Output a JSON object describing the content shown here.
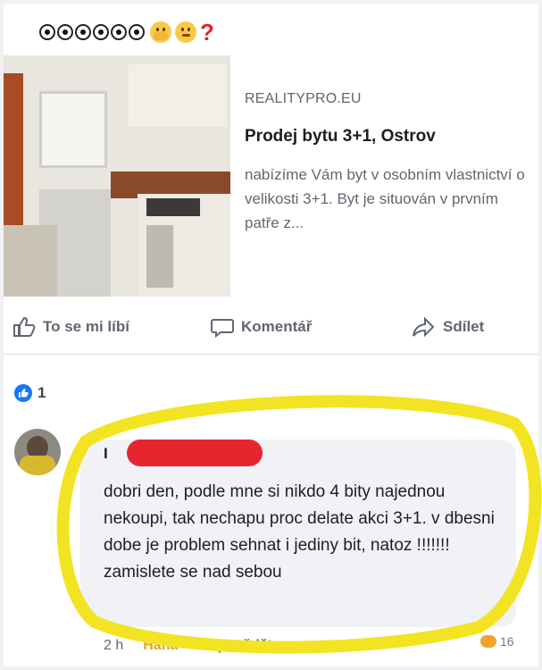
{
  "post": {
    "header_suffix": "?"
  },
  "link_preview": {
    "source": "REALITYPRO.EU",
    "title": "Prodej bytu 3+1, Ostrov",
    "description": "nabízíme Vám byt v osobním vlastnictví o velikosti 3+1. Byt je situován v prvním patře z..."
  },
  "actions": {
    "like": "To se mi líbí",
    "comment": "Komentář",
    "share": "Sdílet"
  },
  "reactions": {
    "count": "1"
  },
  "comment": {
    "author_initial": "I",
    "text": "dobri den, podle mne si nikdo 4 bity najednou nekoupi, tak nechapu proc delate akci 3+1. v dbesni dobe je problem sehnat i jediny bit, natoz !!!!!!! zamislete se nad sebou",
    "timestamp": "2 h",
    "haha": "Haha",
    "reply": "Odpovědět",
    "reaction_count": "16"
  },
  "colors": {
    "facebook_blue": "#1877f2",
    "highlight_yellow": "#f2e422",
    "redaction_red": "#e5262f"
  }
}
